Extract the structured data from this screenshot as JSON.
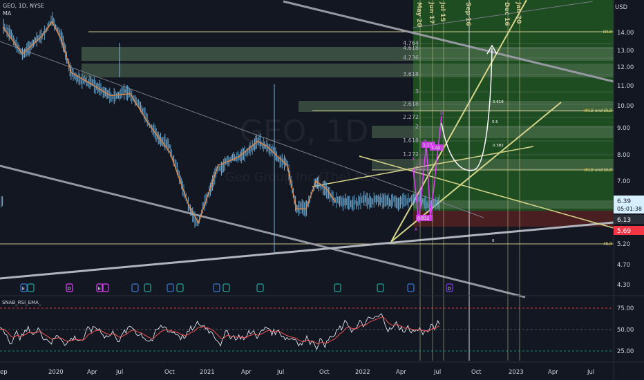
{
  "header": {
    "symbol_line": "GEO, 1D, NYSE",
    "indicator_line": "MA",
    "watermark_symbol": "GEO, 1D",
    "watermark_name": "Geo Group Inc (The) REIT"
  },
  "price_axis": {
    "unit_label": "USD",
    "ticks": [
      "14.00",
      "13.00",
      "12.00",
      "11.00",
      "10.00",
      "9.00",
      "8.00",
      "7.00",
      "5.20",
      "4.70",
      "4.30"
    ],
    "current_price": "6.39",
    "countdown": "05:01:38",
    "label_613": "6.13",
    "label_569": "5.69"
  },
  "rsi_panel": {
    "name": "SNAB_RSI_EMA_",
    "ticks": [
      "75.00",
      "50.00",
      "25.00"
    ]
  },
  "time_axis": [
    "ep",
    "2020",
    "Apr",
    "Jul",
    "Oct",
    "2021",
    "Apr",
    "Jul",
    "Oct",
    "2022",
    "Apr",
    "Jul",
    "Oct",
    "2023",
    "Apr",
    "Jul"
  ],
  "date_labels": [
    "May 20",
    "Jun 17",
    "Jul 15",
    "Sep 16",
    "Dec 16",
    "Jan 20"
  ],
  "fib_levels": [
    "4.764",
    "4.618",
    "4.236",
    "3.618",
    "3",
    "2.618",
    "2.272",
    "2",
    "1.618",
    "1.272",
    "1"
  ],
  "zone_labels": [
    "WLB",
    "WLB and DLB",
    "WLB and DLB",
    "MLB"
  ],
  "annotations": [
    "0.618",
    "0.5",
    "0.382",
    "0"
  ],
  "pattern_labels": [
    "X",
    "A",
    "B",
    "C",
    "D",
    "1.13",
    "1.42",
    "0.832"
  ],
  "event_labels": [
    "E",
    "D",
    "E",
    "D"
  ],
  "chart_data": {
    "type": "line",
    "title": "GEO, 1D, NYSE",
    "ylabel": "USD",
    "ylim": [
      4.1,
      15.8
    ],
    "series": [
      {
        "name": "MA",
        "x": [
          "2019-09",
          "2019-11",
          "2020-01",
          "2020-02",
          "2020-03",
          "2020-04",
          "2020-06",
          "2020-08",
          "2020-10",
          "2020-12",
          "2021-02",
          "2021-04",
          "2021-05",
          "2021-07",
          "2021-09",
          "2021-11",
          "2021-12",
          "2022-02",
          "2022-03",
          "2022-04",
          "2022-05",
          "2022-06",
          "2022-07"
        ],
        "values": [
          14.3,
          12.8,
          13.8,
          14.6,
          13.6,
          11.7,
          11.1,
          10.5,
          10.6,
          9.1,
          8.1,
          6.3,
          5.8,
          7.6,
          7.9,
          8.5,
          8.3,
          7.6,
          6.2,
          6.2,
          7.0,
          6.8,
          6.4
        ]
      }
    ],
    "rsi": {
      "name": "SNAB_RSI_EMA_",
      "ylim": [
        15,
        85
      ],
      "levels": [
        75,
        50,
        25
      ]
    }
  }
}
